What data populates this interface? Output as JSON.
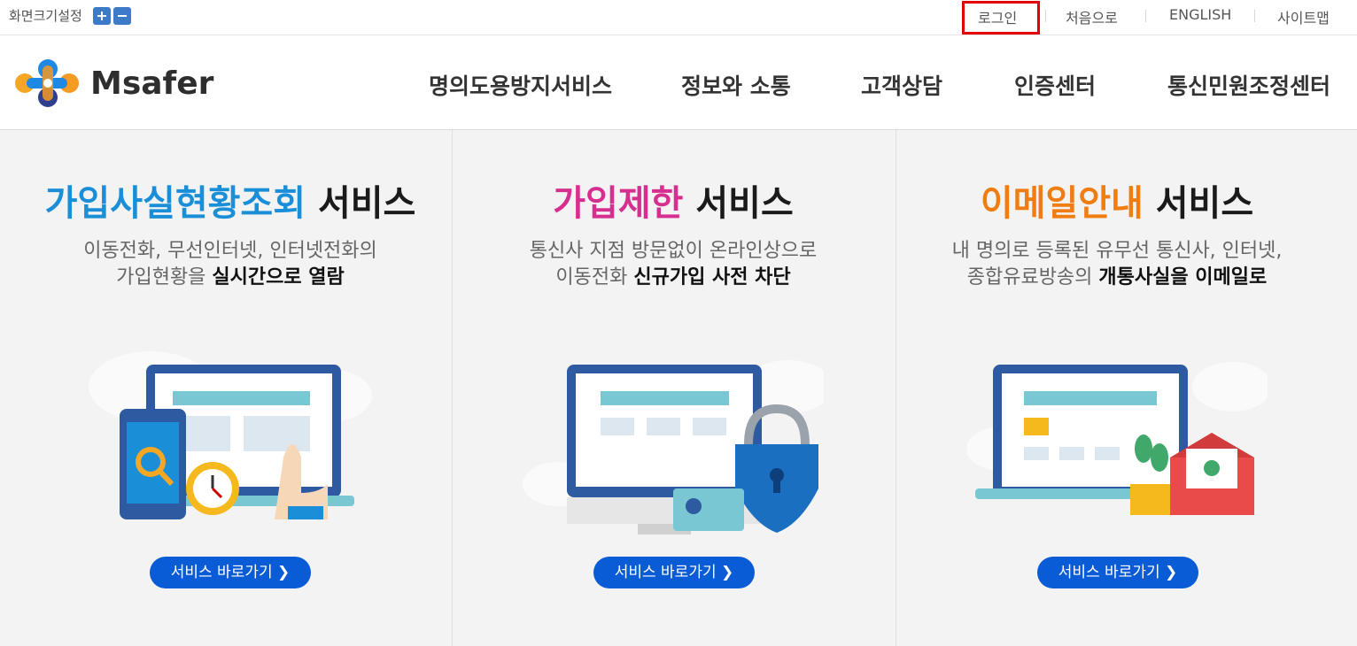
{
  "topbar": {
    "font_size_label": "화면크기설정",
    "font_plus": "font-size-plus-icon",
    "font_minus": "font-size-minus-icon",
    "links": [
      "로그인",
      "처음으로",
      "ENGLISH",
      "사이트맵"
    ]
  },
  "header": {
    "logo_text": "Msafer",
    "nav": [
      "명의도용방지서비스",
      "정보와 소통",
      "고객상담",
      "인증센터",
      "통신민원조정센터"
    ]
  },
  "services": [
    {
      "title_highlight": "가입사실현황조회",
      "title_rest": " 서비스",
      "color": "#1a8fd8",
      "desc_line1": "이동전화, 무선인터넷, 인터넷전화의",
      "desc_line2_prefix": "가입현황을 ",
      "desc_line2_bold": "실시간으로 열람",
      "button": "서비스 바로가기 ❯",
      "icon": "monitor-phone-search-clock-illustration"
    },
    {
      "title_highlight": "가입제한",
      "title_rest": " 서비스",
      "color": "#d62f8f",
      "desc_line1": "통신사 지점 방문없이 온라인상으로",
      "desc_line2_prefix": "이동전화 ",
      "desc_line2_bold": "신규가입 사전 차단",
      "button": "서비스 바로가기 ❯",
      "icon": "monitor-lock-idcard-illustration"
    },
    {
      "title_highlight": "이메일안내",
      "title_rest": " 서비스",
      "color": "#f07d12",
      "desc_line1": "내 명의로 등록된 유무선 통신사, 인터넷,",
      "desc_line2_prefix": "종합유료방송의 ",
      "desc_line2_bold": "개통사실을 이메일로",
      "button": "서비스 바로가기 ❯",
      "icon": "laptop-envelope-plant-illustration"
    }
  ]
}
